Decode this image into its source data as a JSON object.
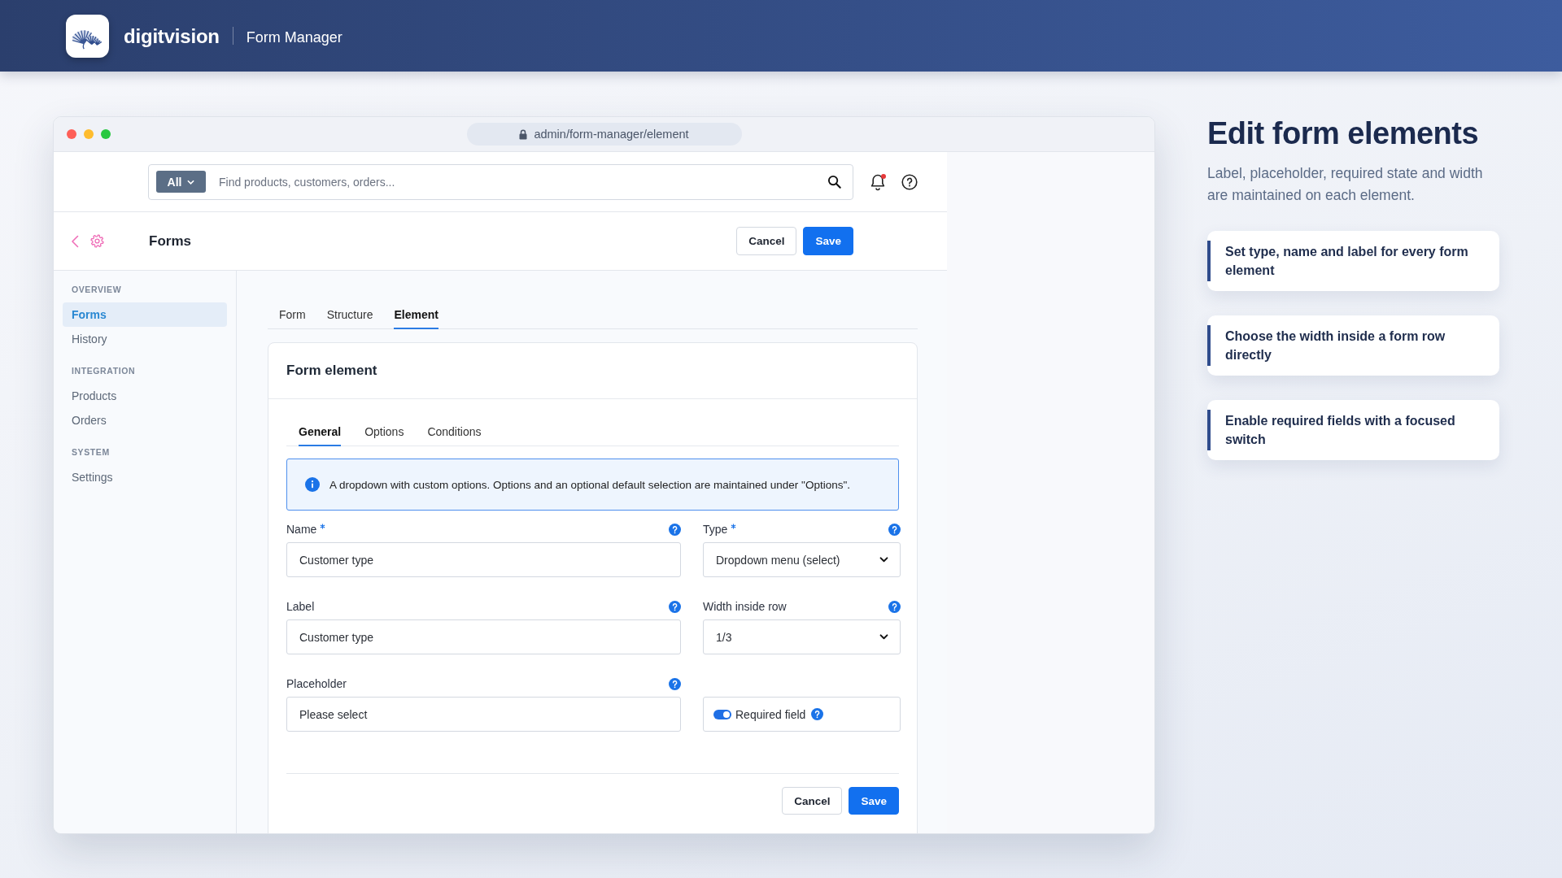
{
  "header": {
    "brand": "digitvision",
    "app_name": "Form Manager"
  },
  "browser": {
    "url": "admin/form-manager/element"
  },
  "toolbar": {
    "scope": {
      "label": "All"
    },
    "search": {
      "placeholder": "Find products, customers, orders..."
    },
    "notifications": {
      "unread": true
    }
  },
  "page_header": {
    "title": "Forms",
    "buttons": [
      {
        "label": "Cancel",
        "kind": "secondary"
      },
      {
        "label": "Save",
        "kind": "primary"
      }
    ]
  },
  "sidebar": {
    "sections": [
      {
        "heading": "OVERVIEW",
        "items": [
          {
            "label": "Forms",
            "selected": true
          },
          {
            "label": "History",
            "selected": false
          }
        ]
      },
      {
        "heading": "INTEGRATION",
        "items": [
          {
            "label": "Products",
            "selected": false
          },
          {
            "label": "Orders",
            "selected": false
          }
        ]
      },
      {
        "heading": "SYSTEM",
        "items": [
          {
            "label": "Settings",
            "selected": false
          }
        ]
      }
    ]
  },
  "tabs": [
    {
      "label": "Form",
      "selected": false
    },
    {
      "label": "Structure",
      "selected": false
    },
    {
      "label": "Element",
      "selected": true
    }
  ],
  "card": {
    "title": "Form element",
    "tabs": [
      {
        "label": "General",
        "selected": true
      },
      {
        "label": "Options",
        "selected": false
      },
      {
        "label": "Conditions",
        "selected": false
      }
    ],
    "info": "A dropdown with custom options. Options and an optional default selection are maintained under \"Options\".",
    "fields": [
      {
        "kind": "text",
        "label": "Name",
        "required": true,
        "value": "Customer type"
      },
      {
        "kind": "select",
        "label": "Type",
        "required": true,
        "value": "Dropdown menu (select)"
      },
      {
        "kind": "text",
        "label": "Label",
        "required": false,
        "value": "Customer type"
      },
      {
        "kind": "select",
        "label": "Width inside row",
        "required": false,
        "value": "1/3"
      },
      {
        "kind": "text",
        "label": "Placeholder",
        "required": false,
        "value": "Please select"
      },
      {
        "kind": "switch",
        "label": "Required field",
        "on": true
      }
    ],
    "buttons": [
      {
        "label": "Cancel",
        "kind": "secondary"
      },
      {
        "label": "Save",
        "kind": "primary"
      }
    ]
  },
  "intro": {
    "title": "Edit form elements",
    "text": "Label, placeholder, required state and width are maintained on each element.",
    "highlights": [
      "Set type, name and label for every form element",
      "Choose the width inside a form row directly",
      "Enable required fields with a focused switch"
    ]
  }
}
